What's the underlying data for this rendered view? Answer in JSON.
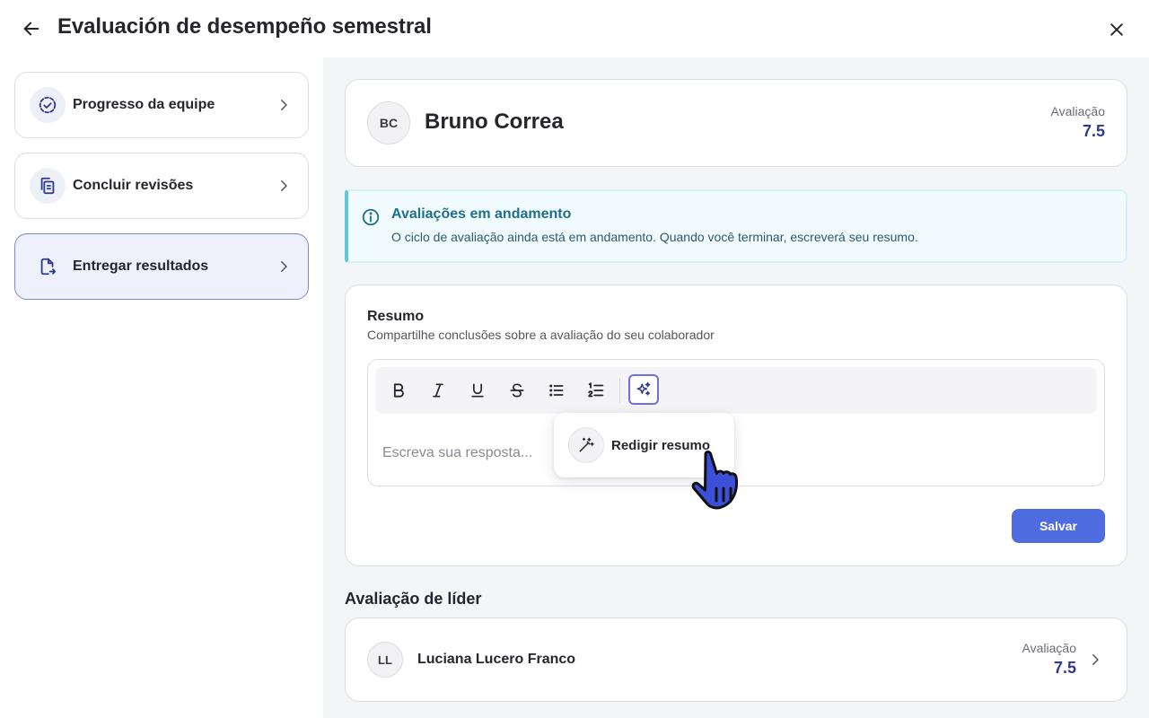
{
  "header": {
    "title": "Evaluación de desempeño semestral"
  },
  "sidebar": {
    "items": [
      {
        "label": "Progresso da equipe",
        "icon": "progress-check-icon",
        "active": false
      },
      {
        "label": "Concluir revisões",
        "icon": "copy-documents-icon",
        "active": false
      },
      {
        "label": "Entregar resultados",
        "icon": "file-export-icon",
        "active": true
      }
    ]
  },
  "employee": {
    "initials": "BC",
    "name": "Bruno Correa",
    "rating_label": "Avaliação",
    "rating_value": "7.5"
  },
  "alert": {
    "title": "Avaliações em andamento",
    "text": "O ciclo de avaliação ainda está em andamento. Quando você terminar, escreverá seu resumo."
  },
  "summary": {
    "title": "Resumo",
    "subtitle": "Compartilhe conclusões sobre a avaliação do seu colaborador",
    "placeholder": "Escreva sua resposta...",
    "toolbar": [
      "bold",
      "italic",
      "underline",
      "strikethrough",
      "bullet-list",
      "numbered-list",
      "ai-sparkle"
    ],
    "menu_item": "Redigir resumo",
    "save_label": "Salvar"
  },
  "leader": {
    "section_title": "Avaliação de líder",
    "initials": "LL",
    "name": "Luciana Lucero Franco",
    "rating_label": "Avaliação",
    "rating_value": "7.5"
  },
  "colors": {
    "primary": "#4f6be0",
    "rating": "#2f3a8f",
    "alert_accent": "#5ec7de",
    "alert_title": "#1f6f8b",
    "cursor": "#3b4fd8"
  }
}
